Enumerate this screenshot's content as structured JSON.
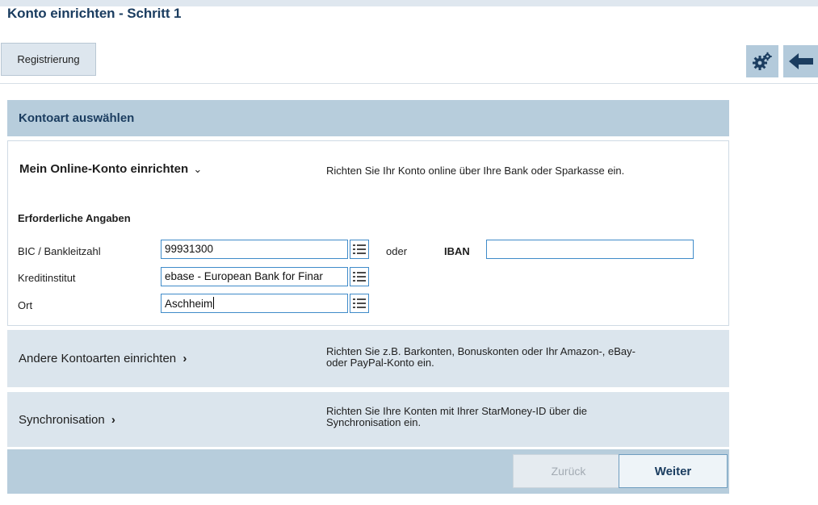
{
  "window": {
    "title": "Konto einrichten - Schritt 1"
  },
  "tabs": [
    {
      "label": "Registrierung"
    }
  ],
  "toolbar": {
    "settings_icon": "gears-icon",
    "back_icon": "arrow-left-icon"
  },
  "panel": {
    "heading": "Kontoart auswählen"
  },
  "online_konto": {
    "title": "Mein Online-Konto einrichten",
    "chevron": "⌄",
    "description": "Richten Sie Ihr Konto online über Ihre Bank oder Sparkasse ein.",
    "required_heading": "Erforderliche Angaben",
    "fields": {
      "bic": {
        "label": "BIC / Bankleitzahl",
        "value": "99931300"
      },
      "or_text": "oder",
      "iban": {
        "label": "IBAN",
        "value": ""
      },
      "kreditinstitut": {
        "label": "Kreditinstitut",
        "value": "ebase - European Bank for Finar"
      },
      "ort": {
        "label": "Ort",
        "value": "Aschheim"
      }
    }
  },
  "other_accounts": {
    "label": "Andere Kontoarten einrichten",
    "chevron": "›",
    "description_line1": "Richten Sie z.B. Barkonten, Bonuskonten oder Ihr Amazon-, eBay-",
    "description_line2": "oder PayPal-Konto ein."
  },
  "sync": {
    "label": "Synchronisation",
    "chevron": "›",
    "description_line1": "Richten Sie Ihre Konten mit Ihrer StarMoney-ID über die",
    "description_line2": "Synchronisation ein."
  },
  "footer": {
    "back_label": "Zurück",
    "next_label": "Weiter"
  },
  "colors": {
    "title": "#1b3d60",
    "panel": "#b7cddc",
    "option_bg": "#dbe5ed",
    "input_border": "#3f8bc9"
  }
}
